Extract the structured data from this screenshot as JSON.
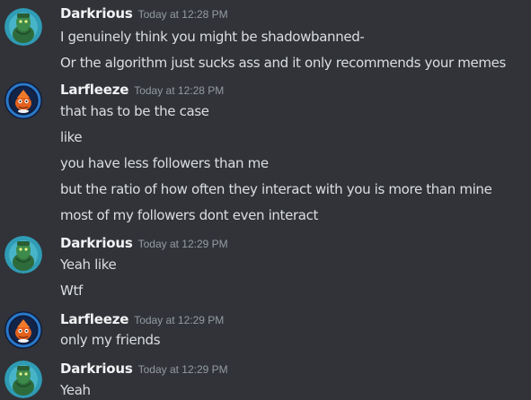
{
  "messages": [
    {
      "author": "Darkrious",
      "avatar_icon": "green-creature-avatar-icon",
      "timestamp": "Today at 12:28 PM",
      "lines": [
        "I genuinely think you might be shadowbanned-",
        "Or the algorithm just sucks ass and it only recommends your memes"
      ]
    },
    {
      "author": "Larfleeze",
      "avatar_icon": "orange-creature-avatar-icon",
      "timestamp": "Today at 12:28 PM",
      "lines": [
        "that has to be the case",
        "like",
        "you have less followers than me",
        "but the ratio of how often they interact with you is more than mine",
        "most of my followers dont even interact"
      ]
    },
    {
      "author": "Darkrious",
      "avatar_icon": "green-creature-avatar-icon",
      "timestamp": "Today at 12:29 PM",
      "lines": [
        "Yeah like",
        "Wtf"
      ]
    },
    {
      "author": "Larfleeze",
      "avatar_icon": "orange-creature-avatar-icon",
      "timestamp": "Today at 12:29 PM",
      "lines": [
        "only my friends"
      ]
    },
    {
      "author": "Darkrious",
      "avatar_icon": "green-creature-avatar-icon",
      "timestamp": "Today at 12:29 PM",
      "lines": [
        "Yeah"
      ]
    }
  ],
  "colors": {
    "background": "#313338",
    "username": "#f2f3f5",
    "timestamp": "#949ba4",
    "message_text": "#dbdee1"
  }
}
